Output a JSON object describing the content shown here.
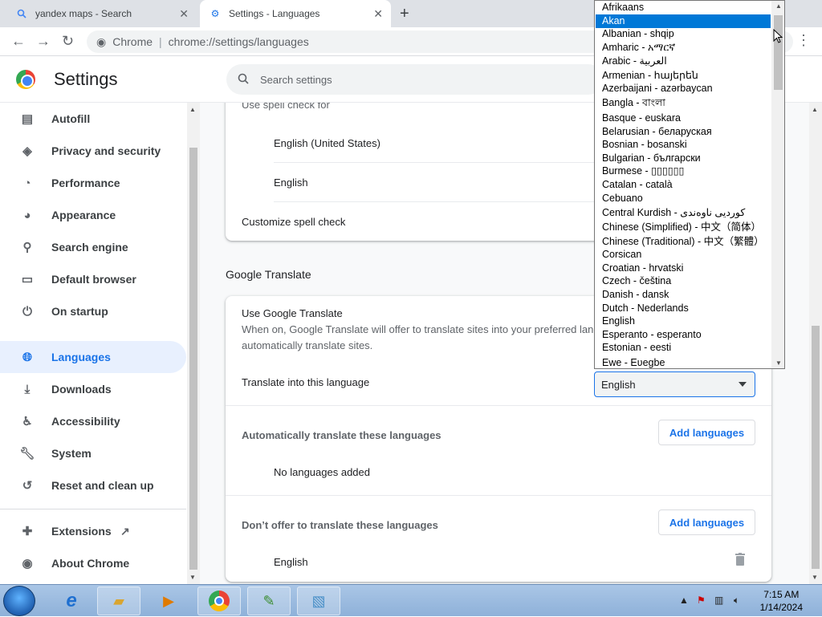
{
  "tabs": [
    {
      "title": "yandex maps - Search",
      "icon": "search-icon"
    },
    {
      "title": "Settings - Languages",
      "icon": "gear-icon"
    }
  ],
  "toolbar": {
    "site_label": "Chrome",
    "url": "chrome://settings/languages"
  },
  "header": {
    "title": "Settings",
    "search_placeholder": "Search settings"
  },
  "sidebar": {
    "items": [
      {
        "label": "Autofill",
        "icon": "clipboard-icon"
      },
      {
        "label": "Privacy and security",
        "icon": "shield-icon"
      },
      {
        "label": "Performance",
        "icon": "gauge-icon"
      },
      {
        "label": "Appearance",
        "icon": "palette-icon"
      },
      {
        "label": "Search engine",
        "icon": "search-icon"
      },
      {
        "label": "Default browser",
        "icon": "browser-icon"
      },
      {
        "label": "On startup",
        "icon": "power-icon"
      },
      {
        "label": "Languages",
        "icon": "globe-icon",
        "active": true
      },
      {
        "label": "Downloads",
        "icon": "download-icon"
      },
      {
        "label": "Accessibility",
        "icon": "accessibility-icon"
      },
      {
        "label": "System",
        "icon": "wrench-icon"
      },
      {
        "label": "Reset and clean up",
        "icon": "history-icon"
      },
      {
        "label": "Extensions",
        "icon": "puzzle-icon"
      },
      {
        "label": "About Chrome",
        "icon": "chrome-icon"
      }
    ]
  },
  "spellcheck": {
    "use_label": "Use spell check for",
    "languages": [
      "English (United States)",
      "English"
    ],
    "customize_label": "Customize spell check"
  },
  "translate": {
    "section_title": "Google Translate",
    "use_title": "Use Google Translate",
    "use_desc_line1": "When on, Google Translate will offer to translate sites into your preferred lang",
    "use_desc_line2": "automatically translate sites.",
    "into_label": "Translate into this language",
    "into_value": "English",
    "auto_label": "Automatically translate these languages",
    "add_button": "Add languages",
    "no_languages": "No languages added",
    "dont_offer_label": "Don’t offer to translate these languages",
    "dont_offer_lang": "English"
  },
  "dropdown": {
    "options": [
      "Afrikaans",
      "Akan",
      "Albanian - shqip",
      "Amharic - አማርኛ",
      "Arabic - العربية",
      "Armenian - հայերեն",
      "Azerbaijani - azərbaycan",
      "Bangla - বাংলা",
      "Basque - euskara",
      "Belarusian - беларуская",
      "Bosnian - bosanski",
      "Bulgarian - български",
      "Burmese - ▯▯▯▯▯▯",
      "Catalan - català",
      "Cebuano",
      "Central Kurdish - کوردیی ناوەندی",
      "Chinese (Simplified) - 中文（简体）",
      "Chinese (Traditional) - 中文（繁體）",
      "Corsican",
      "Croatian - hrvatski",
      "Czech - čeština",
      "Danish - dansk",
      "Dutch - Nederlands",
      "English",
      "Esperanto - esperanto",
      "Estonian - eesti",
      "Ewe - Eʋegbe"
    ],
    "selected_index": 1
  },
  "taskbar": {
    "time": "7:15 AM",
    "date": "1/14/2024"
  }
}
